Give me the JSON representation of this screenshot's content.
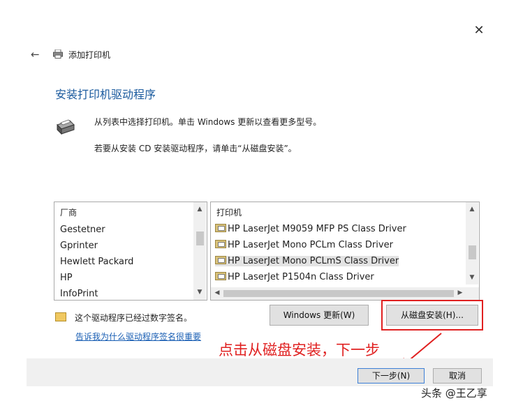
{
  "window": {
    "title": "添加打印机",
    "close_glyph": "✕",
    "back_glyph": "←"
  },
  "heading": "安装打印机驱动程序",
  "instructions": {
    "line1": "从列表中选择打印机。单击 Windows 更新以查看更多型号。",
    "line2": "若要从安装 CD 安装驱动程序，请单击“从磁盘安装”。"
  },
  "manufacturer_list": {
    "header": "厂商",
    "items": [
      "Gestetner",
      "Gprinter",
      "Hewlett Packard",
      "HP",
      "InfoPrint"
    ],
    "selected": "HP"
  },
  "printer_list": {
    "header": "打印机",
    "items": [
      "HP LaserJet M9059 MFP PS Class Driver",
      "HP LaserJet Mono PCLm Class Driver",
      "HP LaserJet Mono PCLmS Class Driver",
      "HP LaserJet P1504n Class Driver"
    ],
    "selected": "HP LaserJet Mono PCLmS Class Driver"
  },
  "signature": {
    "text": "这个驱动程序已经过数字签名。",
    "link": "告诉我为什么驱动程序签名很重要"
  },
  "buttons": {
    "windows_update": "Windows 更新(W)",
    "have_disk": "从磁盘安装(H)...",
    "next": "下一步(N)",
    "cancel": "取消"
  },
  "annotation": "点击从磁盘安装，下一步",
  "watermark": "头条 @王乙享",
  "icons": {
    "back": "back-arrow-icon",
    "printer": "printer-icon",
    "certificate": "certificate-icon"
  },
  "colors": {
    "heading": "#1a5a9e",
    "link": "#1a5fb4",
    "annotation": "#e02020"
  }
}
